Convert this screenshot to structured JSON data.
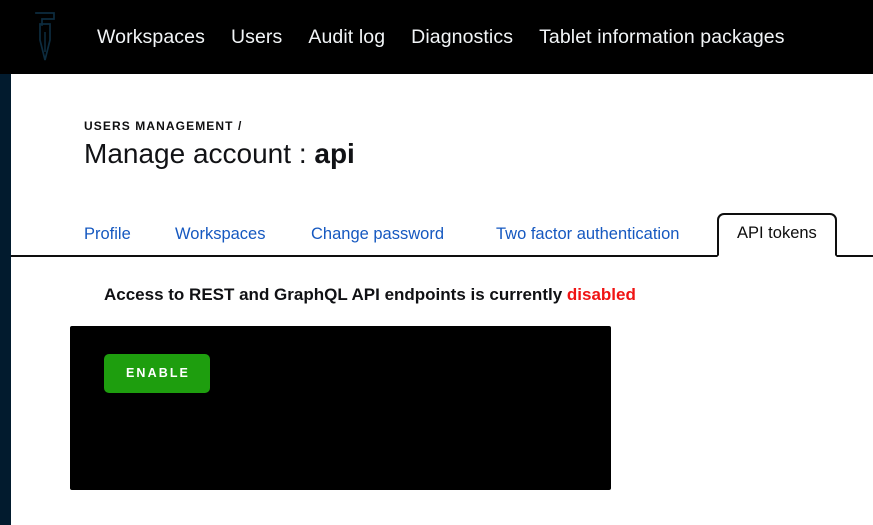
{
  "topnav": {
    "logo_icon": "pen-nib-logo-icon",
    "links": [
      {
        "label": "Workspaces"
      },
      {
        "label": "Users"
      },
      {
        "label": "Audit log"
      },
      {
        "label": "Diagnostics"
      },
      {
        "label": "Tablet information packages"
      }
    ]
  },
  "header": {
    "breadcrumb": "USERS MANAGEMENT /",
    "title_prefix": "Manage account : ",
    "title_account": "api"
  },
  "tabs": [
    {
      "label": "Profile",
      "active": false
    },
    {
      "label": "Workspaces",
      "active": false
    },
    {
      "label": "Change password",
      "active": false
    },
    {
      "label": "Two factor authentication",
      "active": false
    },
    {
      "label": "API tokens",
      "active": true
    }
  ],
  "content": {
    "status_text": "Access to REST and GraphQL API endpoints is currently ",
    "status_value": "disabled",
    "enable_label": "ENABLE"
  },
  "colors": {
    "topbar_bg": "#000000",
    "left_rail": "#021b2e",
    "link_blue": "#1558c0",
    "status_red": "#f01414",
    "enable_green": "#1e9e0e",
    "panel_black": "#000000"
  }
}
